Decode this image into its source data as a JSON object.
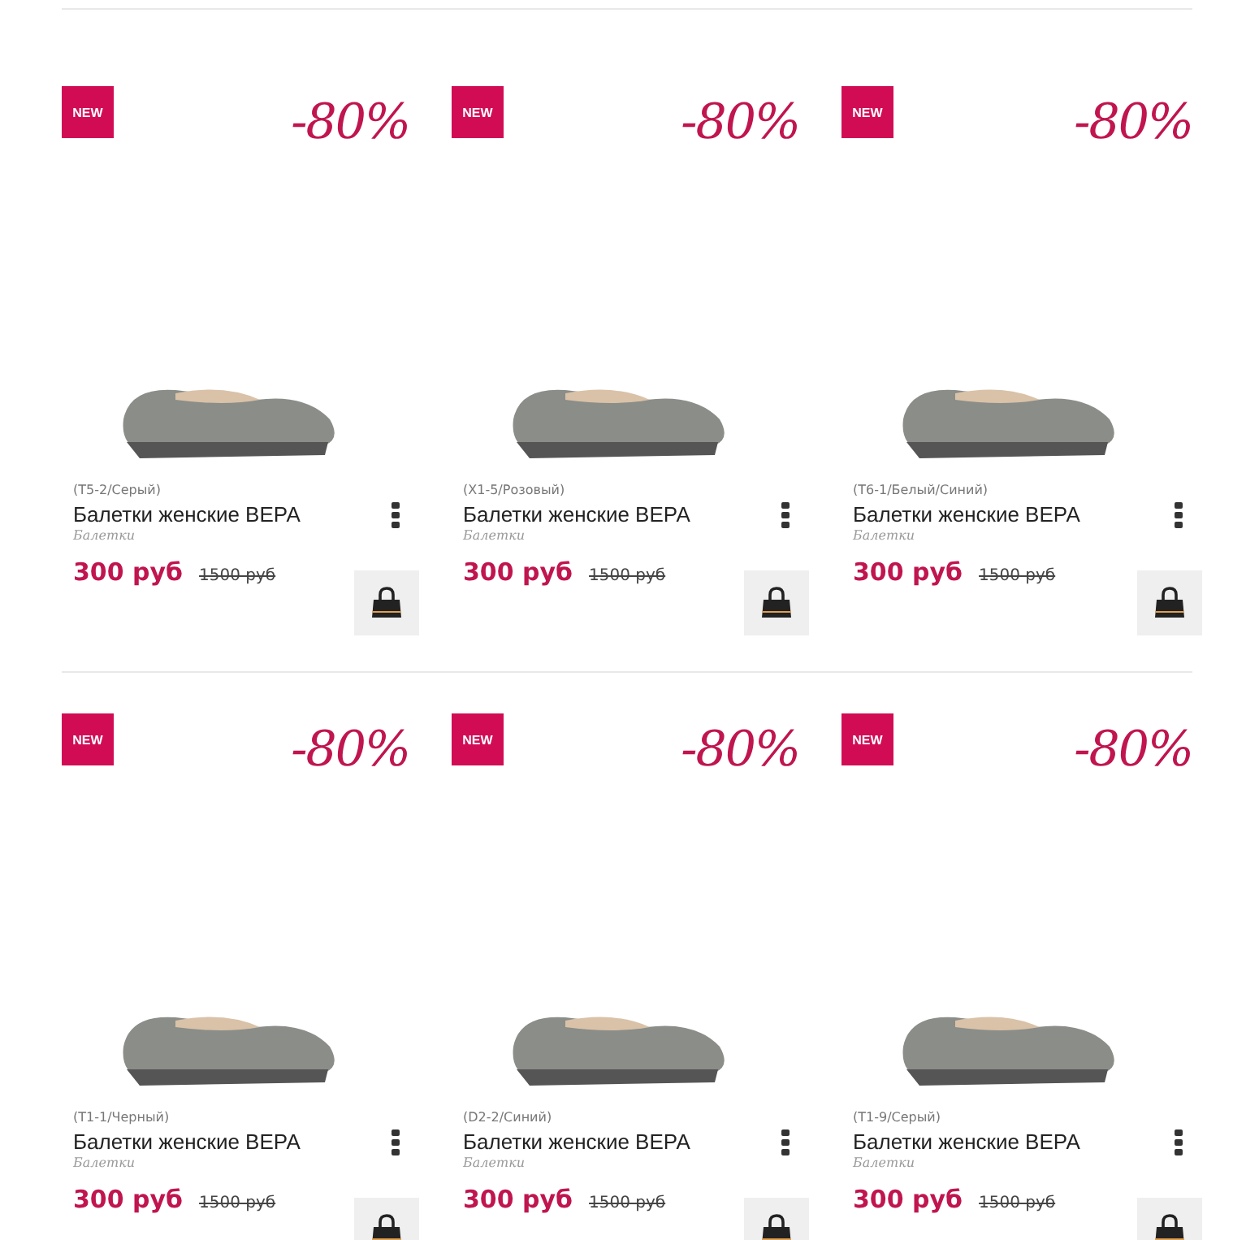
{
  "products": [
    {
      "badge": "NEW",
      "discount": "-80%",
      "code": "(T5-2/Серый)",
      "name": "Балетки женские ВЕРА",
      "category": "Балетки",
      "price": "300 руб",
      "old_price": "1500 руб"
    },
    {
      "badge": "NEW",
      "discount": "-80%",
      "code": "(X1-5/Розовый)",
      "name": "Балетки женские ВЕРА",
      "category": "Балетки",
      "price": "300 руб",
      "old_price": "1500 руб"
    },
    {
      "badge": "NEW",
      "discount": "-80%",
      "code": "(T6-1/Белый/Синий)",
      "name": "Балетки женские ВЕРА",
      "category": "Балетки",
      "price": "300 руб",
      "old_price": "1500 руб"
    },
    {
      "badge": "NEW",
      "discount": "-80%",
      "code": "(T1-1/Черный)",
      "name": "Балетки женские ВЕРА",
      "category": "Балетки",
      "price": "300 руб",
      "old_price": "1500 руб"
    },
    {
      "badge": "NEW",
      "discount": "-80%",
      "code": "(D2-2/Синий)",
      "name": "Балетки женские ВЕРА",
      "category": "Балетки",
      "price": "300 руб",
      "old_price": "1500 руб"
    },
    {
      "badge": "NEW",
      "discount": "-80%",
      "code": "(T1-9/Серый)",
      "name": "Балетки женские ВЕРА",
      "category": "Балетки",
      "price": "300 руб",
      "old_price": "1500 руб"
    }
  ]
}
